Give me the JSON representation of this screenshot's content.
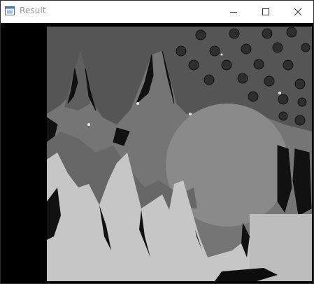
{
  "window": {
    "title": "Result",
    "icon": "opencv-window-icon",
    "controls": {
      "minimize": "minimize-icon",
      "maximize": "maximize-icon",
      "close": "close-icon"
    }
  },
  "image": {
    "name": "disparity-map",
    "colors": {
      "background_dark": "#000000",
      "sky": "#555555",
      "dots": "#2e2e2e",
      "mid_mountains": "#757575",
      "moon": "#8a8a8a",
      "foreground": "#c6c6c6",
      "noise": "#111111"
    }
  }
}
